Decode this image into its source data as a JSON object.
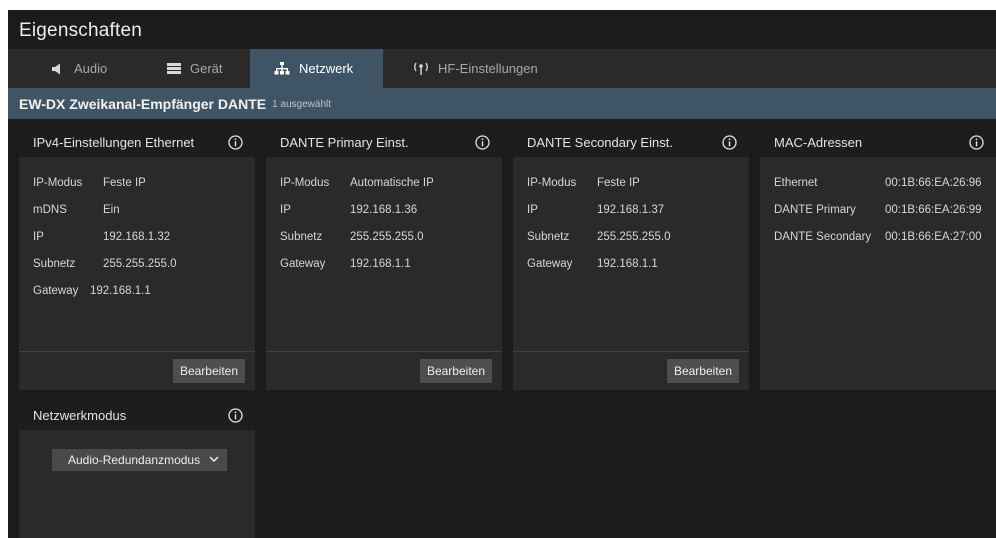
{
  "window": {
    "title": "Eigenschaften"
  },
  "tabs": [
    {
      "label": "Audio",
      "icon": "speaker-icon"
    },
    {
      "label": "Gerät",
      "icon": "device-icon"
    },
    {
      "label": "Netzwerk",
      "icon": "network-icon",
      "active": true
    },
    {
      "label": "HF-Einstellungen",
      "icon": "antenna-icon"
    }
  ],
  "device": {
    "name": "EW-DX Zweikanal-Empfänger DANTE",
    "selection": "1 ausgewählt"
  },
  "cards": {
    "ipv4": {
      "title": "IPv4-Einstellungen Ethernet",
      "rows": [
        {
          "k": "IP-Modus",
          "v": "Feste IP"
        },
        {
          "k": "mDNS",
          "v": "Ein"
        },
        {
          "k": "IP",
          "v": "192.168.1.32"
        },
        {
          "k": "Subnetz",
          "v": "255.255.255.0"
        },
        {
          "k": "Gateway",
          "v": "192.168.1.1"
        }
      ],
      "button": "Bearbeiten"
    },
    "dante_primary": {
      "title": "DANTE Primary Einst.",
      "rows": [
        {
          "k": "IP-Modus",
          "v": "Automatische IP"
        },
        {
          "k": "IP",
          "v": "192.168.1.36"
        },
        {
          "k": "Subnetz",
          "v": "255.255.255.0"
        },
        {
          "k": "Gateway",
          "v": "192.168.1.1"
        }
      ],
      "button": "Bearbeiten"
    },
    "dante_secondary": {
      "title": "DANTE Secondary Einst.",
      "rows": [
        {
          "k": "IP-Modus",
          "v": "Feste IP"
        },
        {
          "k": "IP",
          "v": "192.168.1.37"
        },
        {
          "k": "Subnetz",
          "v": "255.255.255.0"
        },
        {
          "k": "Gateway",
          "v": "192.168.1.1"
        }
      ],
      "button": "Bearbeiten"
    },
    "mac": {
      "title": "MAC-Adressen",
      "rows": [
        {
          "k": "Ethernet",
          "v": "00:1B:66:EA:26:96"
        },
        {
          "k": "DANTE Primary",
          "v": "00:1B:66:EA:26:99"
        },
        {
          "k": "DANTE Secondary",
          "v": "00:1B:66:EA:27:00"
        }
      ]
    },
    "netmode": {
      "title": "Netzwerkmodus",
      "selected": "Audio-Redundanzmodus"
    }
  },
  "colors": {
    "accent": "#3f5566",
    "background": "#1b1b1b",
    "card": "#2a2a2a"
  }
}
